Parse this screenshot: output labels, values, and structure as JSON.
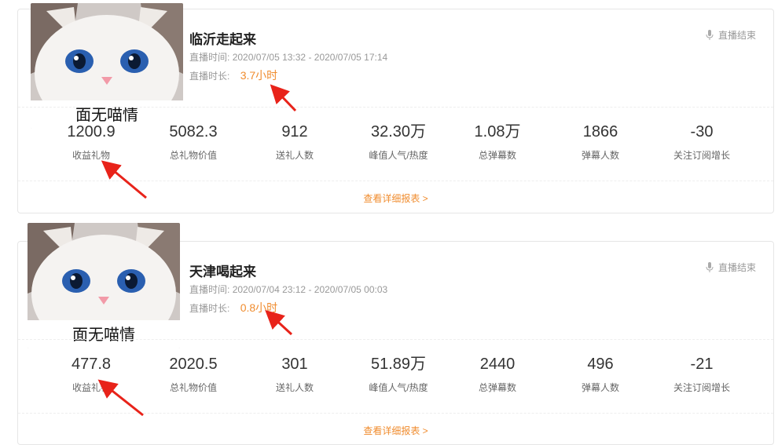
{
  "records": [
    {
      "title": "临沂走起来",
      "time_label": "直播时间:",
      "time_value": "2020/07/05 13:32 - 2020/07/05 17:14",
      "duration_label": "直播时长:",
      "duration_value": "3.7小时",
      "status": "直播结束",
      "thumb_caption": "面无喵情",
      "stats": [
        {
          "value": "1200.9",
          "label": "收益礼物"
        },
        {
          "value": "5082.3",
          "label": "总礼物价值"
        },
        {
          "value": "912",
          "label": "送礼人数"
        },
        {
          "value": "32.30万",
          "label": "峰值人气/热度"
        },
        {
          "value": "1.08万",
          "label": "总弹幕数"
        },
        {
          "value": "1866",
          "label": "弹幕人数"
        },
        {
          "value": "-30",
          "label": "关注订阅增长"
        }
      ],
      "detail_link": "查看详细报表 >"
    },
    {
      "title": "天津喝起来",
      "time_label": "直播时间:",
      "time_value": "2020/07/04 23:12 - 2020/07/05 00:03",
      "duration_label": "直播时长:",
      "duration_value": "0.8小时",
      "status": "直播结束",
      "thumb_caption": "面无喵情",
      "stats": [
        {
          "value": "477.8",
          "label": "收益礼物"
        },
        {
          "value": "2020.5",
          "label": "总礼物价值"
        },
        {
          "value": "301",
          "label": "送礼人数"
        },
        {
          "value": "51.89万",
          "label": "峰值人气/热度"
        },
        {
          "value": "2440",
          "label": "总弹幕数"
        },
        {
          "value": "496",
          "label": "弹幕人数"
        },
        {
          "value": "-21",
          "label": "关注订阅增长"
        }
      ],
      "detail_link": "查看详细报表 >"
    }
  ],
  "colors": {
    "accent": "#f08c2e",
    "annotation_arrow": "#e8231a"
  }
}
